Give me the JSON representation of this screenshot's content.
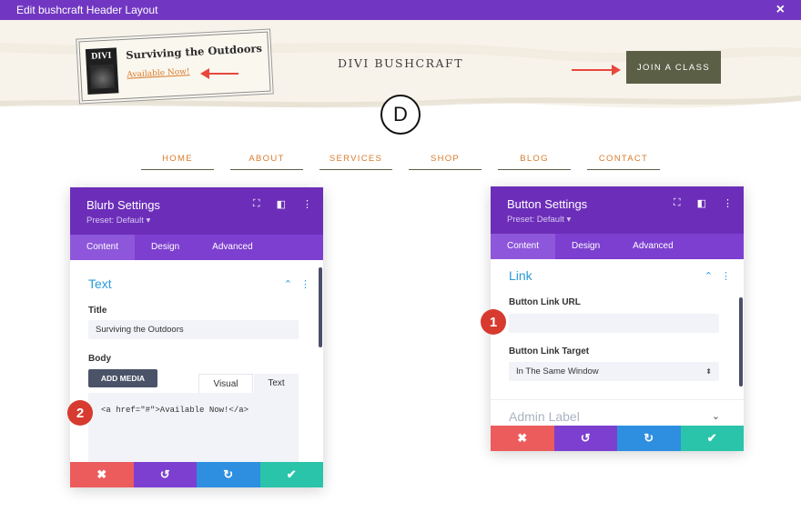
{
  "window": {
    "title": "Edit bushcraft Header Layout",
    "close_icon": "×"
  },
  "header": {
    "logo": {
      "book_text": "DIVI",
      "title": "Surviving the Outdoors",
      "link_text": "Available Now!"
    },
    "site_name": "DIVI BUSHCRAFT",
    "cta_label": "JOIN A CLASS",
    "divi_logo_letter": "D",
    "colors": {
      "accent_orange": "#d97b2b",
      "button_olive": "#5b5f46",
      "arrow_red": "#e8483c"
    }
  },
  "nav": {
    "items": [
      "HOME",
      "ABOUT",
      "SERVICES",
      "SHOP",
      "BLOG",
      "CONTACT"
    ]
  },
  "blurb_panel": {
    "title": "Blurb Settings",
    "preset": "Preset: Default ▾",
    "tabs": [
      "Content",
      "Design",
      "Advanced"
    ],
    "active_tab": "Content",
    "section": "Text",
    "title_label": "Title",
    "title_value": "Surviving the Outdoors",
    "body_label": "Body",
    "add_media": "ADD MEDIA",
    "editor_tabs": [
      "Visual",
      "Text"
    ],
    "body_value": "<a href=\"#\">Available Now!</a>",
    "badge": "2"
  },
  "button_panel": {
    "title": "Button Settings",
    "preset": "Preset: Default ▾",
    "tabs": [
      "Content",
      "Design",
      "Advanced"
    ],
    "active_tab": "Content",
    "section": "Link",
    "url_label": "Button Link URL",
    "url_value": "",
    "target_label": "Button Link Target",
    "target_value": "In The Same Window",
    "admin_label": "Admin Label",
    "badge": "1"
  },
  "actions": {
    "cancel": "✖",
    "undo": "↺",
    "redo": "↻",
    "save": "✔"
  }
}
